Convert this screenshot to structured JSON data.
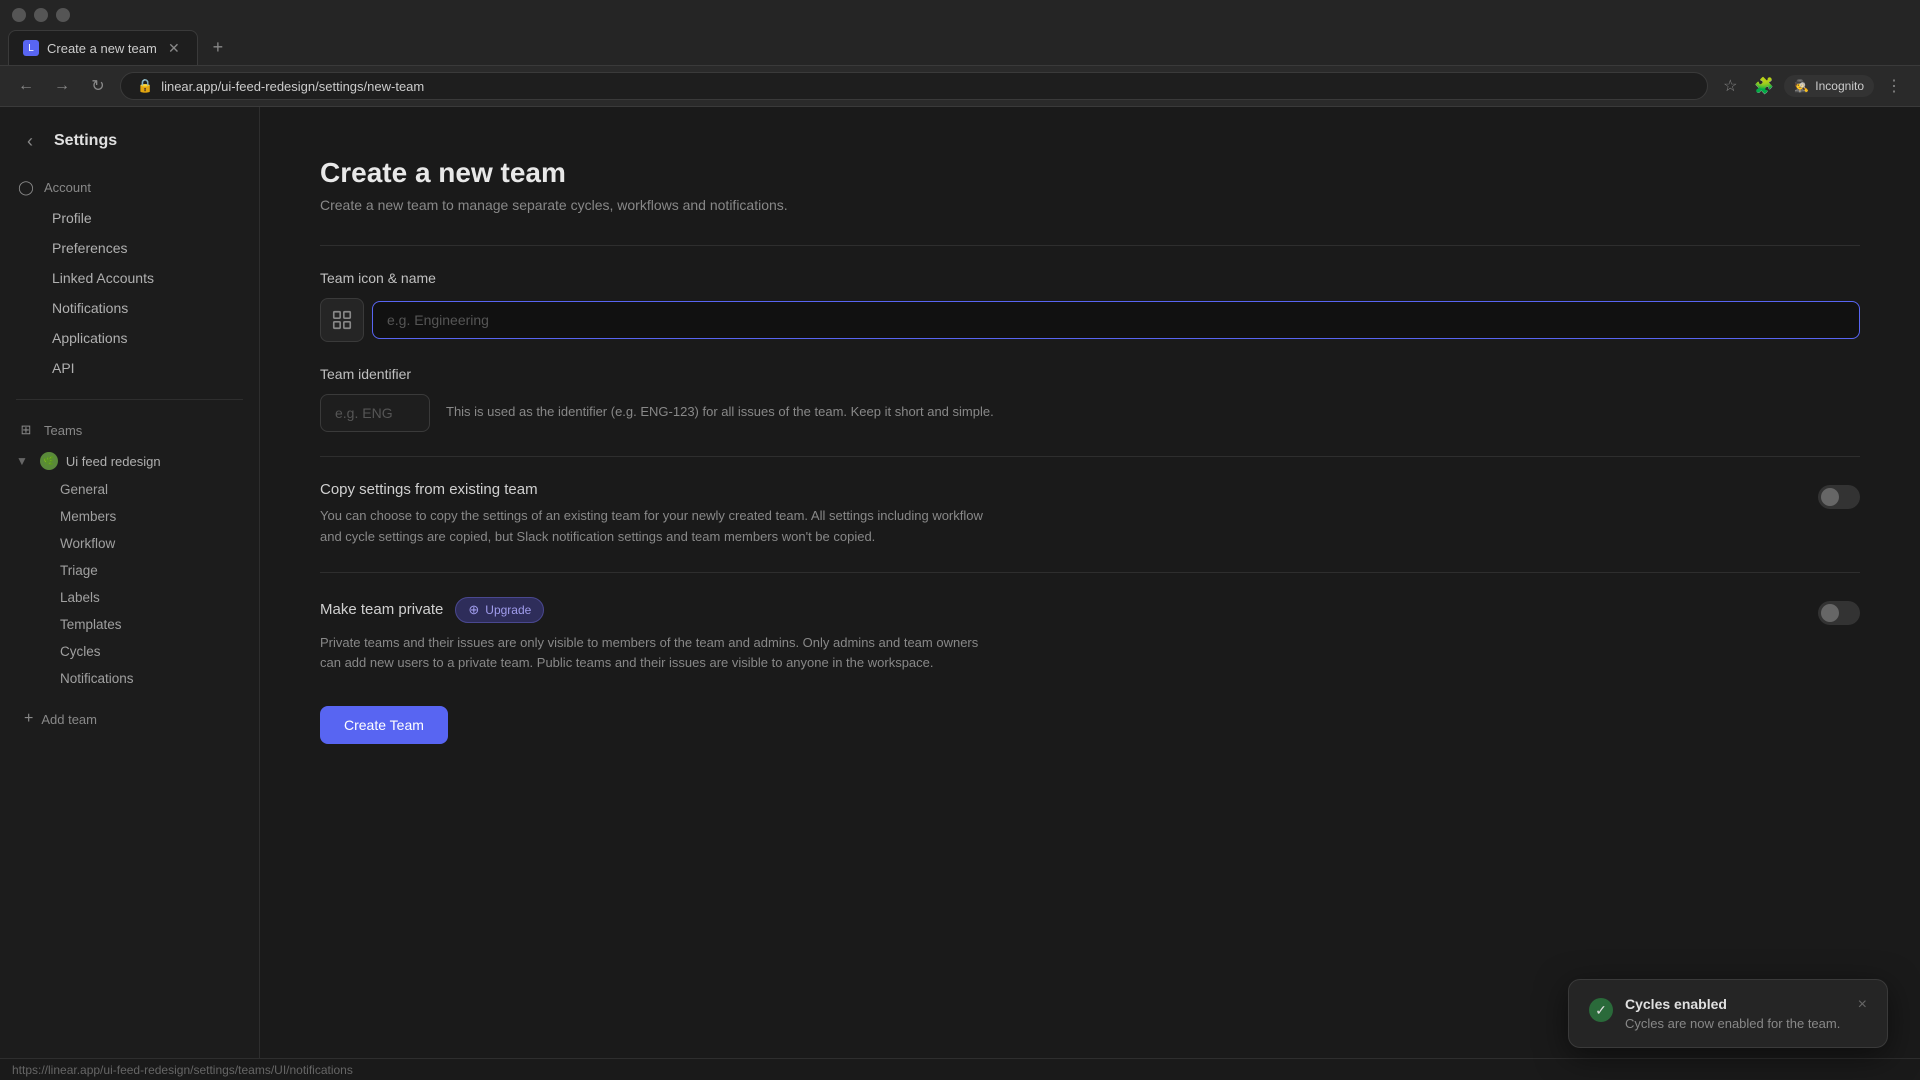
{
  "browser": {
    "tab_title": "Create a new team",
    "url": "linear.app/ui-feed-redesign/settings/new-team",
    "url_display": "linear.app/ui-feed-redesign/settings/new-team",
    "incognito_label": "Incognito",
    "status_url": "https://linear.app/ui-feed-redesign/settings/teams/UI/notifications"
  },
  "sidebar": {
    "title": "Settings",
    "back_label": "←",
    "account_section": "Account",
    "items": [
      {
        "id": "profile",
        "label": "Profile"
      },
      {
        "id": "preferences",
        "label": "Preferences"
      },
      {
        "id": "linked-accounts",
        "label": "Linked Accounts"
      },
      {
        "id": "notifications",
        "label": "Notifications"
      },
      {
        "id": "applications",
        "label": "Applications"
      },
      {
        "id": "api",
        "label": "API"
      }
    ],
    "teams_section": "Teams",
    "team_name": "Ui feed redesign",
    "team_sub_items": [
      {
        "id": "general",
        "label": "General"
      },
      {
        "id": "members",
        "label": "Members"
      },
      {
        "id": "workflow",
        "label": "Workflow"
      },
      {
        "id": "triage",
        "label": "Triage"
      },
      {
        "id": "labels",
        "label": "Labels"
      },
      {
        "id": "templates",
        "label": "Templates"
      },
      {
        "id": "cycles",
        "label": "Cycles"
      },
      {
        "id": "notifications",
        "label": "Notifications"
      }
    ],
    "add_team_label": "Add team"
  },
  "main": {
    "page_title": "Create a new team",
    "page_subtitle": "Create a new team to manage separate cycles, workflows and notifications.",
    "team_icon_name_label": "Team icon & name",
    "team_name_placeholder": "e.g. Engineering",
    "team_identifier_label": "Team identifier",
    "team_identifier_placeholder": "e.g. ENG",
    "team_identifier_hint": "This is used as the identifier (e.g. ENG-123) for all issues of the team. Keep it short and simple.",
    "copy_settings_title": "Copy settings from existing team",
    "copy_settings_desc": "You can choose to copy the settings of an existing team for your newly created team. All settings including workflow and cycle settings are copied, but Slack notification settings and team members won't be copied.",
    "make_private_title": "Make team private",
    "upgrade_label": "Upgrade",
    "make_private_desc": "Private teams and their issues are only visible to members of the team and admins. Only admins and team owners can add new users to a private team. Public teams and their issues are visible to anyone in the workspace.",
    "create_team_btn": "Create Team"
  },
  "toast": {
    "title": "Cycles enabled",
    "message": "Cycles are now enabled for the team.",
    "close_label": "×"
  }
}
